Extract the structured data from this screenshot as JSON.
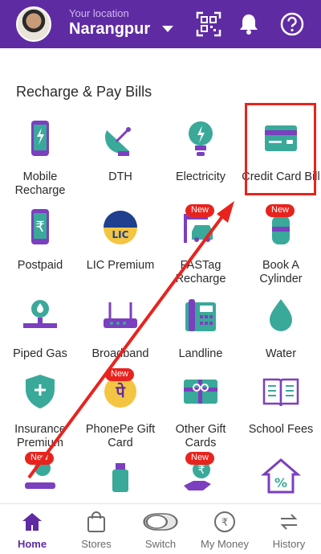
{
  "header": {
    "location_caption": "Your location",
    "location_name": "Narangpur",
    "icons": [
      "qr-scan-icon",
      "bell-icon",
      "help-icon"
    ]
  },
  "section_title": "Recharge & Pay Bills",
  "tiles": [
    {
      "label": "Mobile Recharge",
      "icon": "mobile-icon"
    },
    {
      "label": "DTH",
      "icon": "satellite-dish-icon"
    },
    {
      "label": "Electricity",
      "icon": "bulb-icon"
    },
    {
      "label": "Credit Card Bill",
      "icon": "credit-card-icon"
    },
    {
      "label": "Postpaid",
      "icon": "rupee-phone-icon"
    },
    {
      "label": "LIC Premium",
      "icon": "lic-logo-icon"
    },
    {
      "label": "FASTag Recharge",
      "icon": "toll-car-icon",
      "badge": "New"
    },
    {
      "label": "Book A Cylinder",
      "icon": "gas-cylinder-icon",
      "badge": "New"
    },
    {
      "label": "Piped Gas",
      "icon": "gas-meter-icon"
    },
    {
      "label": "Broadband",
      "icon": "router-icon"
    },
    {
      "label": "Landline",
      "icon": "telephone-icon"
    },
    {
      "label": "Water",
      "icon": "water-drop-icon"
    },
    {
      "label": "Insurance Premium",
      "icon": "shield-plus-icon"
    },
    {
      "label": "PhonePe Gift Card",
      "icon": "phonepe-coin-icon",
      "badge": "New"
    },
    {
      "label": "Other Gift Cards",
      "icon": "gift-card-icon"
    },
    {
      "label": "School Fees",
      "icon": "book-icon"
    },
    {
      "label": "",
      "icon": "rent-hand-icon",
      "badge": "New"
    },
    {
      "label": "",
      "icon": "usb-stick-icon"
    },
    {
      "label": "",
      "icon": "rupee-hand-icon",
      "badge": "New"
    },
    {
      "label": "",
      "icon": "house-percent-icon"
    }
  ],
  "bottom_nav": [
    {
      "label": "Home",
      "icon": "home-icon",
      "active": true
    },
    {
      "label": "Stores",
      "icon": "shopping-bag-icon"
    },
    {
      "label": "Switch",
      "icon": "switch-toggle-icon"
    },
    {
      "label": "My Money",
      "icon": "rupee-circle-icon"
    },
    {
      "label": "History",
      "icon": "swap-arrows-icon"
    }
  ],
  "colors": {
    "brand": "#5f2ba3",
    "accent_teal": "#3aa99a",
    "icon_purple": "#7b3fbf",
    "badge_red": "#e8231e",
    "annotation_red": "#e8231e"
  }
}
